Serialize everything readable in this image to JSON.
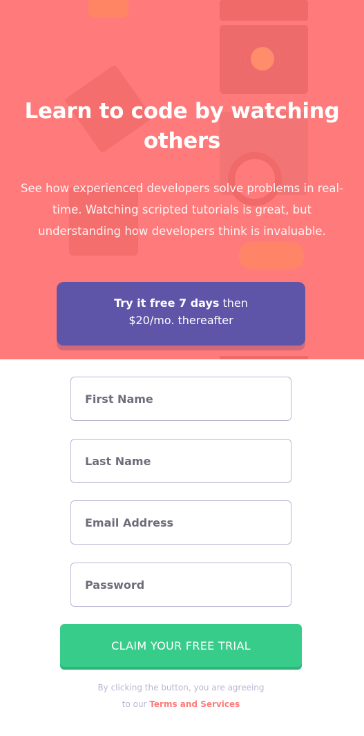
{
  "hero": {
    "title": "Learn to code by watching others",
    "description": "See how experienced developers solve problems in real-time. Watching scripted tutorials is great, but understanding how developers think is invaluable."
  },
  "offer": {
    "highlight": "Try it free 7 days",
    "rest": " then",
    "price_line": "$20/mo. thereafter"
  },
  "form": {
    "first_name_placeholder": "First Name",
    "last_name_placeholder": "Last Name",
    "email_placeholder": "Email Address",
    "password_placeholder": "Password",
    "submit_label": "CLAIM YOUR FREE TRIAL"
  },
  "terms": {
    "line1": "By clicking the button, you are agreeing",
    "line2_prefix": "to our ",
    "link": "Terms and Services"
  },
  "colors": {
    "hero_bg": "#ff7a7a",
    "offer_bg": "#5e55a8",
    "button_bg": "#38cc8b",
    "link": "#ff7a7a"
  }
}
